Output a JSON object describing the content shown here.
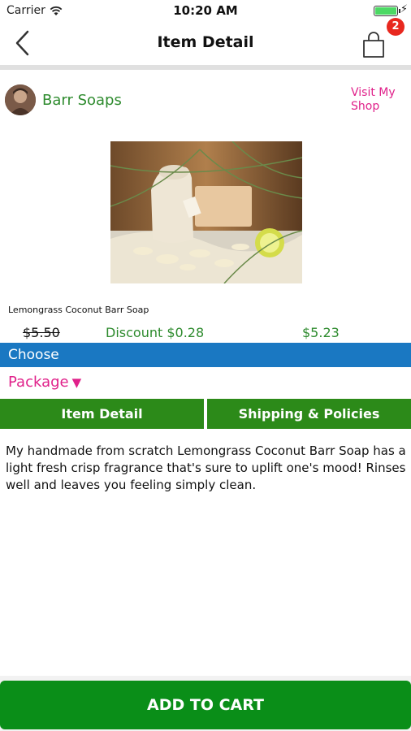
{
  "status": {
    "carrier": "Carrier",
    "time": "10:20 AM"
  },
  "nav": {
    "title": "Item Detail",
    "cart_count": "2"
  },
  "shop": {
    "name": "Barr Soaps",
    "visit_label": "Visit My Shop"
  },
  "product": {
    "name": "Lemongrass Coconut Barr Soap",
    "original_price": "$5.50",
    "discount": "Discount $0.28",
    "price": "$5.23"
  },
  "options": {
    "section_label": "Choose",
    "package_label": "Package",
    "package_arrow": "▼"
  },
  "tabs": [
    {
      "label": "Item Detail"
    },
    {
      "label": "Shipping & Policies"
    }
  ],
  "description": "My handmade from scratch Lemongrass Coconut Barr Soap has a light fresh crisp fragrance that's sure to uplift one's mood!  Rinses well and leaves you feeling simply clean.",
  "actions": {
    "add_to_cart": "ADD TO CART"
  },
  "colors": {
    "brand_green": "#2c8a19",
    "cta_green": "#0a8e18",
    "choose_blue": "#1a78c2",
    "accent_pink": "#e0218a",
    "badge_red": "#e8281f"
  }
}
